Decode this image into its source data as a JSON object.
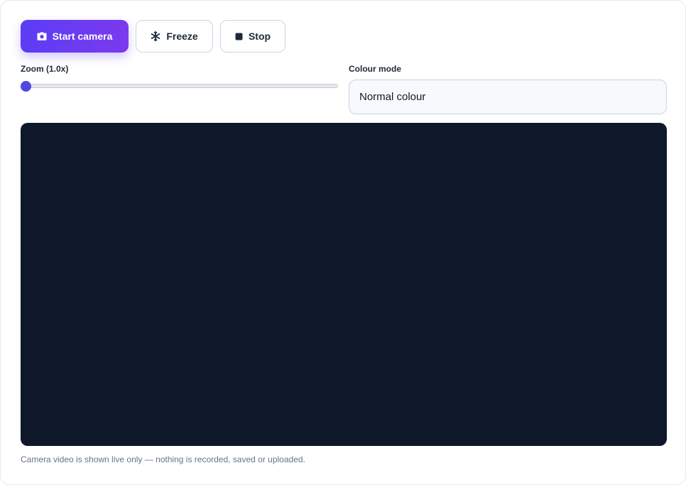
{
  "toolbar": {
    "start_label": "Start camera",
    "start_icon": "camera-icon",
    "freeze_label": "Freeze",
    "freeze_icon": "snowflake-icon",
    "stop_label": "Stop",
    "stop_icon": "stop-square-icon"
  },
  "zoom": {
    "label": "Zoom (1.0x)",
    "value": 1.0,
    "fraction": 0
  },
  "colour_mode": {
    "label": "Colour mode",
    "selected": "Normal colour"
  },
  "footer": {
    "note": "Camera video is shown live only — nothing is recorded, saved or uploaded."
  },
  "colors": {
    "accent": "#5b3df5",
    "video_background": "#0f172a"
  }
}
